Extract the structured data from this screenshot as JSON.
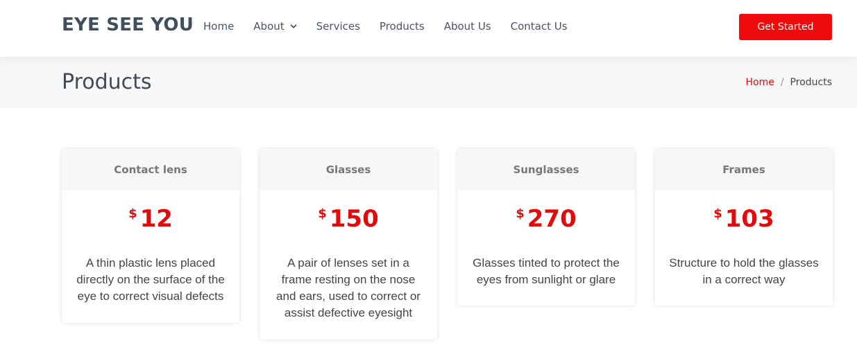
{
  "header": {
    "logo": "EYE SEE YOU",
    "nav": [
      {
        "label": "Home"
      },
      {
        "label": "About",
        "has_dropdown": true
      },
      {
        "label": "Services"
      },
      {
        "label": "Products"
      },
      {
        "label": "About Us"
      },
      {
        "label": "Contact Us"
      }
    ],
    "cta_label": "Get Started"
  },
  "page": {
    "title": "Products",
    "breadcrumb": {
      "home": "Home",
      "separator": "/",
      "current": "Products"
    }
  },
  "products": [
    {
      "name": "Contact lens",
      "currency": "$",
      "price": "12",
      "description": "A thin plastic lens placed directly on the surface of the eye to correct visual defects"
    },
    {
      "name": "Glasses",
      "currency": "$",
      "price": "150",
      "description": "A pair of lenses set in a frame resting on the nose and ears, used to correct or assist defective eyesight"
    },
    {
      "name": "Sunglasses",
      "currency": "$",
      "price": "270",
      "description": "Glasses tinted to protect the eyes from sunlight or glare"
    },
    {
      "name": "Frames",
      "currency": "$",
      "price": "103",
      "description": "Structure to hold the glasses in a correct way"
    }
  ],
  "colors": {
    "accent": "#ee0b0b",
    "logo": "#3f4f5f",
    "band": "#f6f7f9"
  },
  "icons": {
    "about_dropdown": "chevron-down-icon"
  }
}
